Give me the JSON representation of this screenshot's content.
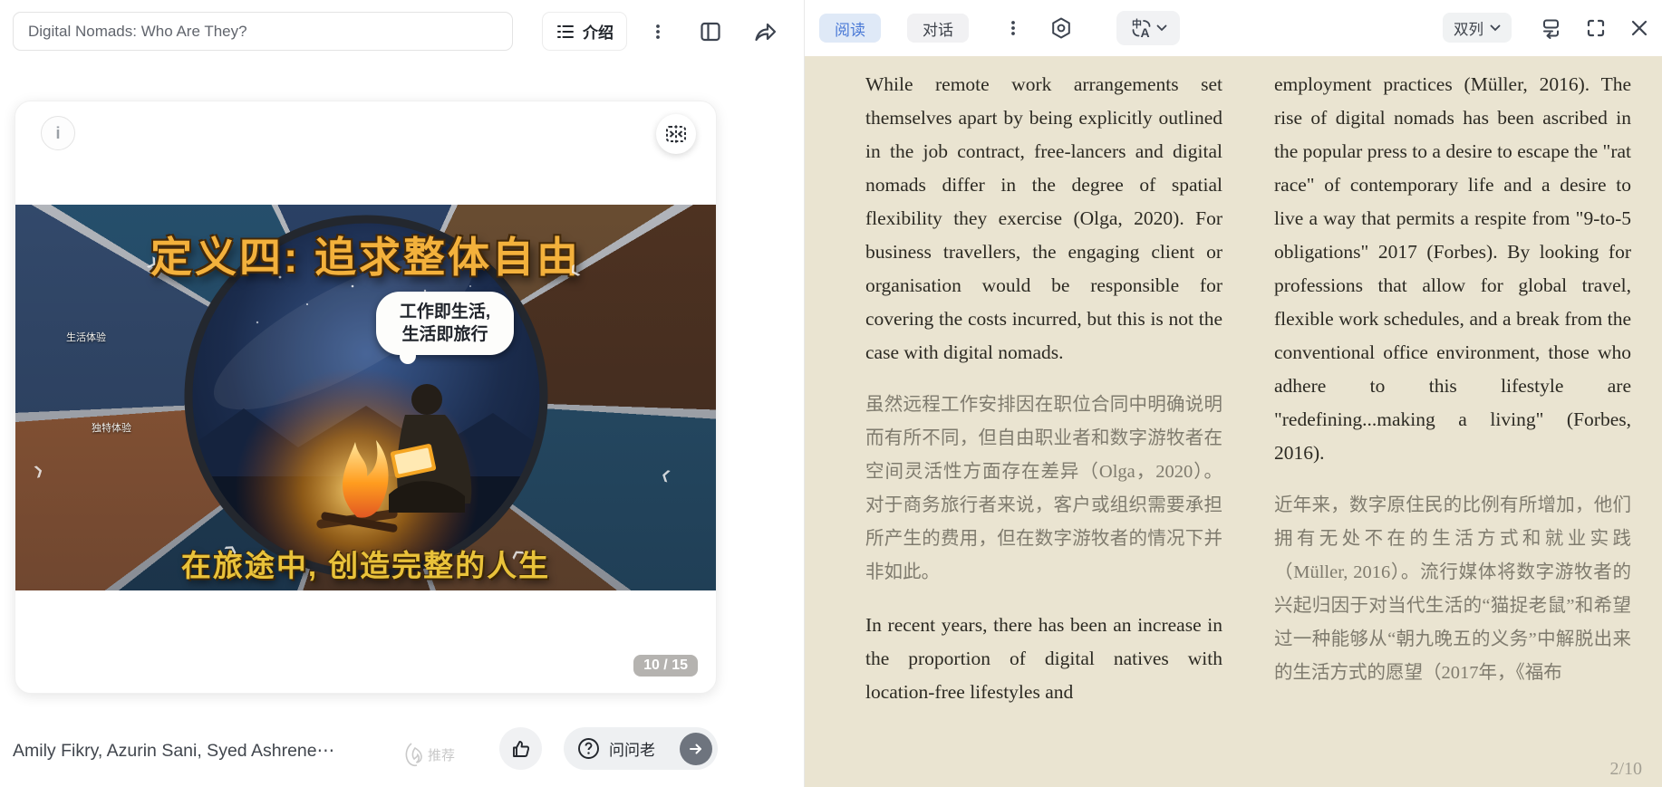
{
  "left_panel": {
    "title_input": {
      "value": "Digital Nomads: Who Are They?"
    },
    "toolbar": {
      "outline_button_label": "介绍"
    },
    "card": {
      "slide": {
        "title": "定义四: 追求整体自由",
        "speech_bubble_line1": "工作即生活,",
        "speech_bubble_line2": "生活即旅行",
        "tagline": "在旅途中, 创造完整的人生",
        "labels": [
          "生活体验",
          "独特体验"
        ]
      },
      "page_badge": "10 / 15"
    },
    "footer": {
      "authors": "Amily Fikry, Azurin Sani, Syed Ashrene⋯",
      "recommend_label": "推荐",
      "ask_button_label": "问问老"
    }
  },
  "reader": {
    "tabs": [
      {
        "label": "阅读",
        "active": true
      },
      {
        "label": "对话",
        "active": false
      }
    ],
    "layout_select": "双列",
    "page_indicator": "2/10",
    "columns": [
      {
        "paragraphs": [
          {
            "lang": "en",
            "text": "While remote work arrangements set themselves apart by being explicitly outlined in the job contract, free-lancers and digital nomads differ in the degree of spatial flexibility they exercise (Olga, 2020). For business travellers, the engaging client or organisation would be responsible for covering the costs incurred, but this is not the case with digital nomads."
          },
          {
            "lang": "zh",
            "text": "虽然远程工作安排因在职位合同中明确说明而有所不同，但自由职业者和数字游牧者在空间灵活性方面存在差异（Olga，2020）。对于商务旅行者来说，客户或组织需要承担所产生的费用，但在数字游牧者的情况下并非如此。"
          },
          {
            "lang": "en",
            "text": "In recent years, there has been an increase in the proportion of digital natives with location-free lifestyles and"
          }
        ]
      },
      {
        "paragraphs": [
          {
            "lang": "en",
            "text": "employment practices (Müller, 2016). The rise of digital nomads has been ascribed in the popular press to a desire to escape the \"rat race\" of contemporary life and a desire to live a way that permits a respite from \"9-to-5 obligations\" 2017 (Forbes). By looking for professions that allow for global travel, flexible work schedules, and a break from the conventional office environment, those who adhere to this lifestyle are \"redefining...making a living\" (Forbes, 2016)."
          },
          {
            "lang": "zh",
            "text": "近年来，数字原住民的比例有所增加，他们拥有无处不在的生活方式和就业实践（Müller, 2016）。流行媒体将数字游牧者的兴起归因于对当代生活的“猫捉老鼠”和希望过一种能够从“朝九晚五的义务”中解脱出来的生活方式的愿望（2017年，《福布"
          }
        ]
      }
    ]
  },
  "colors": {
    "reader_background": "#eae4d1",
    "english_text": "#2c2a23",
    "chinese_text": "#7f7b6e",
    "active_tab_bg": "#dfe9f7",
    "active_tab_text": "#4a79d6",
    "slide_title_gold": "#f3b13c",
    "tagline_gold": "#e9c23a",
    "badge_gray": "#b5b3b0"
  },
  "icons": {
    "outline": "list-icon",
    "more_vertical": "⋮",
    "split_view": "layout-columns-icon",
    "share": "share-arrow-icon",
    "settings": "hexagon-gear-icon",
    "translate": "中/A",
    "chevron_down": "∨",
    "page_mode": "page-mode-icon",
    "fullscreen": "fullscreen-icon",
    "close": "✕",
    "info": "i",
    "collapse_horizontal": ">|<",
    "thumbs_up": "thumbs-up-icon",
    "question": "?",
    "arrow_right": "→",
    "ai_sparkle": "ai-flame-icon"
  }
}
